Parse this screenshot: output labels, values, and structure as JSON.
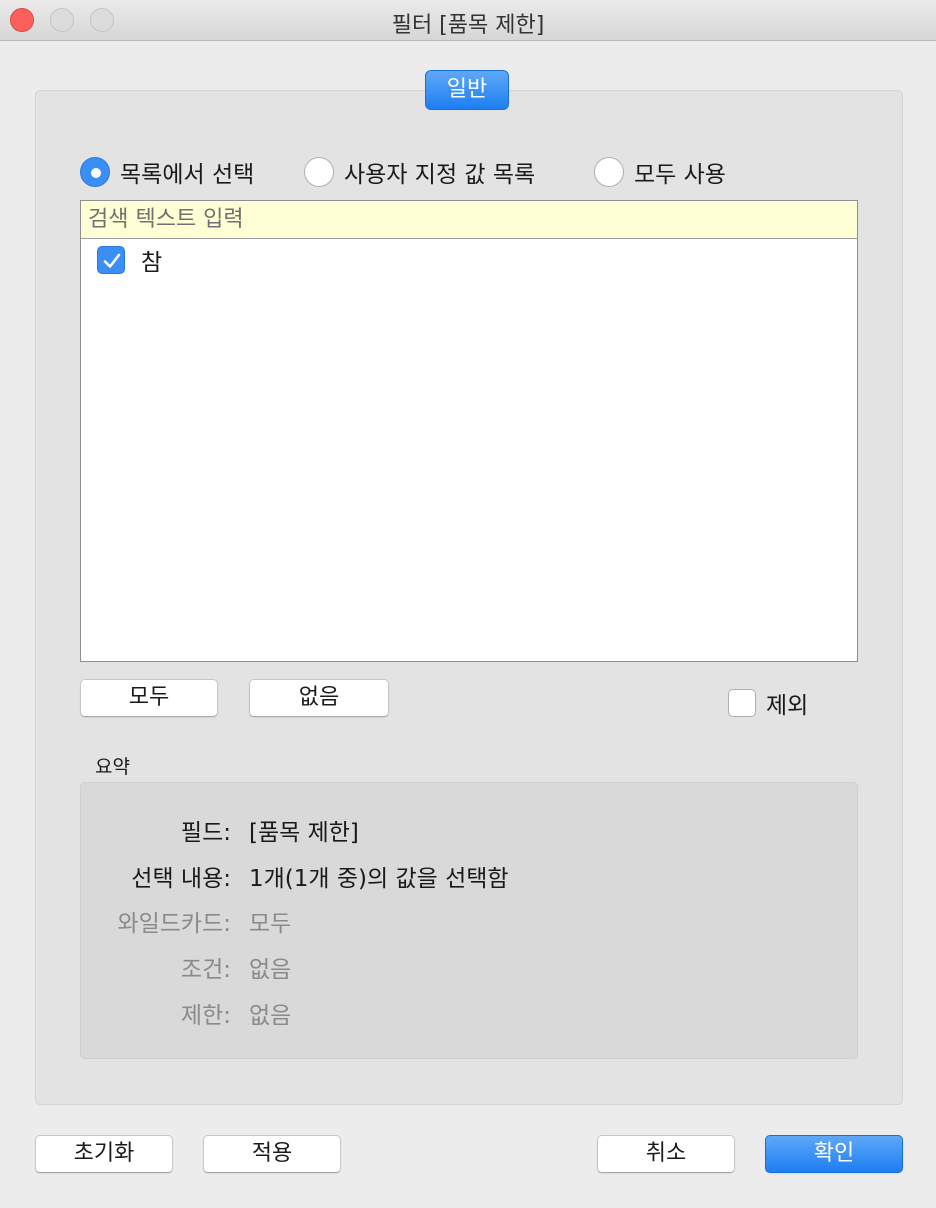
{
  "window": {
    "title": "필터 [품목 제한]"
  },
  "tab": {
    "label": "일반"
  },
  "mode": {
    "options": [
      {
        "label": "목록에서 선택",
        "selected": true
      },
      {
        "label": "사용자 지정 값 목록",
        "selected": false
      },
      {
        "label": "모두 사용",
        "selected": false
      }
    ]
  },
  "list": {
    "search_placeholder": "검색 텍스트 입력",
    "items": [
      {
        "label": "참",
        "checked": true
      }
    ]
  },
  "actions": {
    "all_label": "모두",
    "none_label": "없음",
    "exclude_label": "제외",
    "exclude_checked": false
  },
  "summary": {
    "title": "요약",
    "rows": [
      {
        "key": "필드:",
        "value": "[품목 제한]",
        "dim": false
      },
      {
        "key": "선택 내용:",
        "value": "1개(1개 중)의 값을 선택함",
        "dim": false
      },
      {
        "key": "와일드카드:",
        "value": "모두",
        "dim": true
      },
      {
        "key": "조건:",
        "value": "없음",
        "dim": true
      },
      {
        "key": "제한:",
        "value": "없음",
        "dim": true
      }
    ]
  },
  "footer": {
    "reset_label": "초기화",
    "apply_label": "적용",
    "cancel_label": "취소",
    "ok_label": "확인"
  },
  "colors": {
    "accent": "#1d7ef2",
    "search_bg": "#ffffd6"
  }
}
